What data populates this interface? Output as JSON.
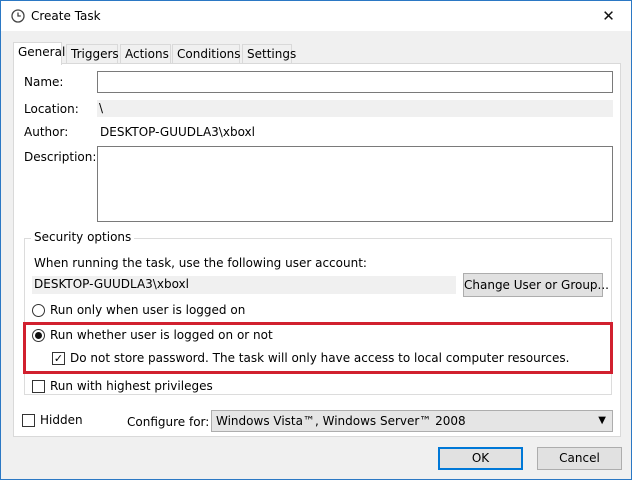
{
  "window": {
    "title": "Create Task",
    "close_glyph": "✕"
  },
  "tabs": [
    {
      "label": "General",
      "active": true
    },
    {
      "label": "Triggers",
      "active": false
    },
    {
      "label": "Actions",
      "active": false
    },
    {
      "label": "Conditions",
      "active": false
    },
    {
      "label": "Settings",
      "active": false
    }
  ],
  "general": {
    "name_label": "Name:",
    "name_value": "",
    "location_label": "Location:",
    "location_value": "\\",
    "author_label": "Author:",
    "author_value": "DESKTOP-GUUDLA3\\xboxl",
    "description_label": "Description:",
    "description_value": ""
  },
  "security": {
    "group_title": "Security options",
    "account_prompt": "When running the task, use the following user account:",
    "account_value": "DESKTOP-GUUDLA3\\xboxl",
    "change_button": "Change User or Group...",
    "radio_logged_on": "Run only when user is logged on",
    "radio_whether": "Run whether user is logged on or not",
    "no_store_password": "Do not store password.  The task will only have access to local computer resources.",
    "highest_privileges": "Run with highest privileges",
    "highlight_color": "#d1202f"
  },
  "footer": {
    "hidden_label": "Hidden",
    "configure_label": "Configure for:",
    "configure_value": "Windows Vista™, Windows Server™ 2008",
    "ok_button": "OK",
    "cancel_button": "Cancel"
  },
  "state": {
    "radio_logged_on_checked": false,
    "radio_whether_checked": true,
    "no_store_password_checked": true,
    "highest_privileges_checked": false,
    "hidden_checked": false
  },
  "colors": {
    "accent": "#0078d7",
    "border_window": "#2b78c4"
  }
}
